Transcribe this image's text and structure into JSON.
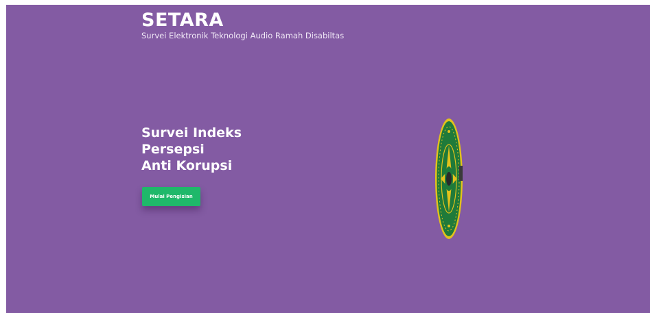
{
  "header": {
    "title": "SETARA",
    "subtitle": "Survei Elektronik Teknologi Audio Ramah Disabiltas"
  },
  "hero": {
    "headline_lines": [
      "Survei Indeks",
      "Persepsi",
      "Anti Korupsi"
    ],
    "cta_label": "Mulai Pengisian"
  },
  "emblem": {
    "icon": "court-emblem-icon"
  },
  "colors": {
    "background": "#835ba3",
    "cta": "#1fb86a",
    "emblem_green": "#1f7a3a",
    "emblem_gold": "#e2c21c"
  }
}
